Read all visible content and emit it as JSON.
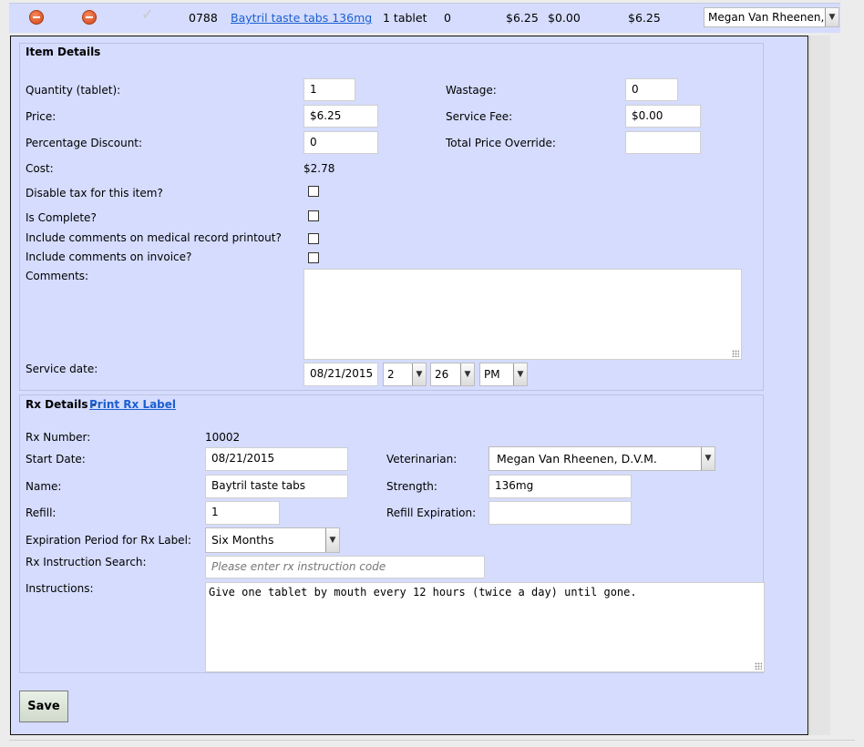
{
  "row": {
    "code": "0788",
    "item_link": "Baytril taste tabs 136mg",
    "qty": "1 tablet",
    "wastage": "0",
    "price": "$6.25",
    "fee": "$0.00",
    "total": "$6.25",
    "vet": "Megan Van Rheenen, D"
  },
  "item": {
    "header": "Item Details",
    "quantity_label": "Quantity (tablet):",
    "quantity_value": "1",
    "wastage_label": "Wastage:",
    "wastage_value": "0",
    "price_label": "Price:",
    "price_value": "$6.25",
    "service_fee_label": "Service Fee:",
    "service_fee_value": "$0.00",
    "pct_discount_label": "Percentage Discount:",
    "pct_discount_value": "0",
    "total_override_label": "Total Price Override:",
    "total_override_value": "",
    "cost_label": "Cost:",
    "cost_value": "$2.78",
    "disable_tax_label": "Disable tax for this item?",
    "is_complete_label": "Is Complete?",
    "comments_medical_label": "Include comments on medical record printout?",
    "comments_invoice_label": "Include comments on invoice?",
    "comments_label": "Comments:",
    "comments_value": "",
    "service_date_label": "Service date:",
    "service_date_value": "08/21/2015",
    "hour": "2",
    "minute": "26",
    "ampm": "PM"
  },
  "rx": {
    "header": "Rx Details -",
    "print_label": "Print Rx Label",
    "number_label": "Rx Number:",
    "number_value": "10002",
    "start_date_label": "Start Date:",
    "start_date_value": "08/21/2015",
    "vet_label": "Veterinarian:",
    "vet_value": "Megan Van Rheenen, D.V.M.",
    "name_label": "Name:",
    "name_value": "Baytril taste tabs",
    "strength_label": "Strength:",
    "strength_value": "136mg",
    "refill_label": "Refill:",
    "refill_value": "1",
    "refill_exp_label": "Refill Expiration:",
    "refill_exp_value": "",
    "exp_period_label": "Expiration Period for Rx Label:",
    "exp_period_value": "Six Months",
    "instr_search_label": "Rx Instruction Search:",
    "instr_search_placeholder": "Please enter rx instruction code",
    "instructions_label": "Instructions:",
    "instructions_value": "Give one tablet by mouth every 12 hours (twice a day) until gone."
  },
  "save_label": "Save",
  "icons": {
    "remove": "minus-circle-icon",
    "check": "check-icon",
    "dropdown": "chevron-down-icon"
  }
}
